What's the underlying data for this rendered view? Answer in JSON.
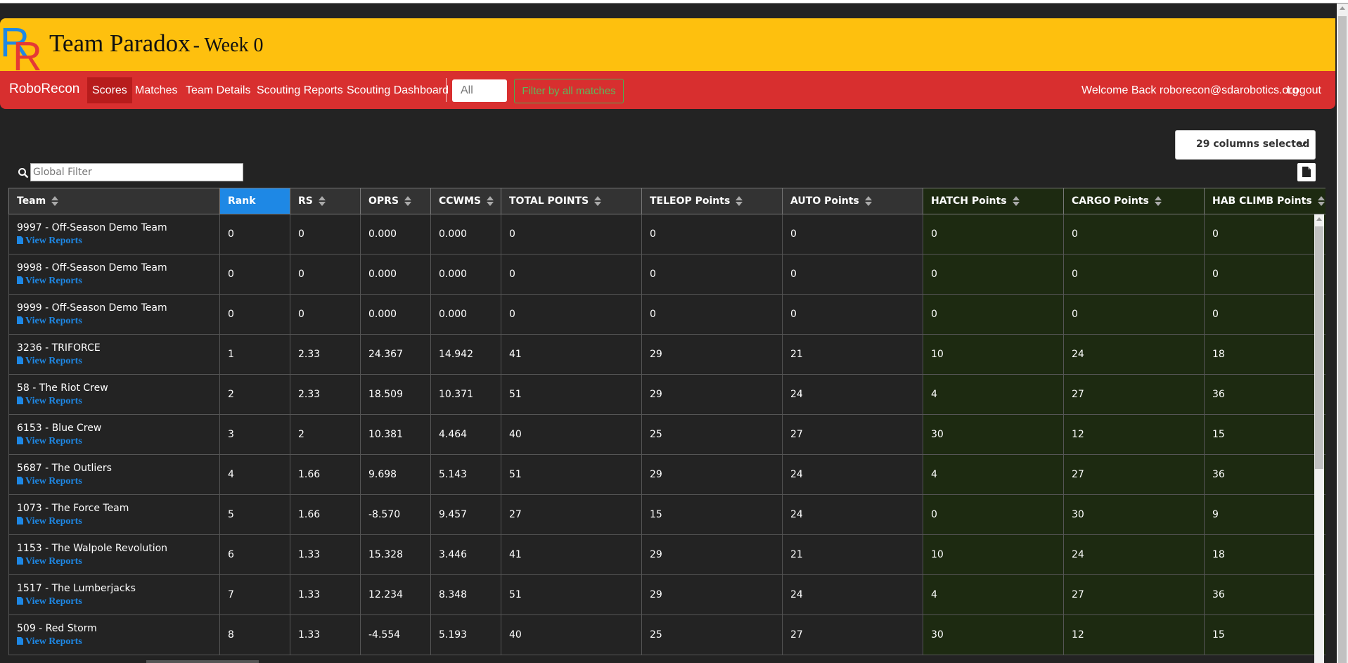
{
  "header": {
    "team": "Team Paradox",
    "week": "- Week 0",
    "logo_letters": [
      "R",
      "R"
    ],
    "colors": {
      "banner": "#fec00e",
      "navbar": "#d82f2f",
      "logo_blue": "#1e88e5",
      "logo_red": "#e53935"
    }
  },
  "nav": {
    "brand": "RoboRecon",
    "items": [
      "Scores",
      "Matches",
      "Team Details",
      "Scouting Reports",
      "Scouting Dashboard"
    ],
    "active": "Scores",
    "filter_placeholder": "All",
    "filter_button": "Filter by all matches",
    "welcome": "Welcome Back roborecon@sdarobotics.org",
    "logout": "Logout"
  },
  "toolbar": {
    "columns_selected": "29 columns selected",
    "global_filter_placeholder": "Global Filter",
    "search_icon": "search-icon",
    "export_icon": "file-icon"
  },
  "table": {
    "headers": [
      "Team",
      "Rank",
      "RS",
      "OPRS",
      "CCWMS",
      "TOTAL POINTS",
      "TELEOP Points",
      "AUTO Points",
      "HATCH Points",
      "CARGO Points",
      "HAB CLIMB Points"
    ],
    "sorted_column": "Rank",
    "link_text": "View Reports",
    "rows": [
      {
        "team": "9997 - Off-Season Demo Team",
        "cells": [
          "0",
          "0",
          "0.000",
          "0.000",
          "0",
          "0",
          "0",
          "0",
          "0",
          "0"
        ]
      },
      {
        "team": "9998 - Off-Season Demo Team",
        "cells": [
          "0",
          "0",
          "0.000",
          "0.000",
          "0",
          "0",
          "0",
          "0",
          "0",
          "0"
        ]
      },
      {
        "team": "9999 - Off-Season Demo Team",
        "cells": [
          "0",
          "0",
          "0.000",
          "0.000",
          "0",
          "0",
          "0",
          "0",
          "0",
          "0"
        ]
      },
      {
        "team": "3236 - TRIFORCE",
        "cells": [
          "1",
          "2.33",
          "24.367",
          "14.942",
          "41",
          "29",
          "21",
          "10",
          "24",
          "18"
        ]
      },
      {
        "team": "58 - The Riot Crew",
        "cells": [
          "2",
          "2.33",
          "18.509",
          "10.371",
          "51",
          "29",
          "24",
          "4",
          "27",
          "36"
        ]
      },
      {
        "team": "6153 - Blue Crew",
        "cells": [
          "3",
          "2",
          "10.381",
          "4.464",
          "40",
          "25",
          "27",
          "30",
          "12",
          "15"
        ]
      },
      {
        "team": "5687 - The Outliers",
        "cells": [
          "4",
          "1.66",
          "9.698",
          "5.143",
          "51",
          "29",
          "24",
          "4",
          "27",
          "36"
        ]
      },
      {
        "team": "1073 - The Force Team",
        "cells": [
          "5",
          "1.66",
          "-8.570",
          "9.457",
          "27",
          "15",
          "24",
          "0",
          "30",
          "9"
        ]
      },
      {
        "team": "1153 - The Walpole Revolution",
        "cells": [
          "6",
          "1.33",
          "15.328",
          "3.446",
          "41",
          "29",
          "21",
          "10",
          "24",
          "18"
        ]
      },
      {
        "team": "1517 - The Lumberjacks",
        "cells": [
          "7",
          "1.33",
          "12.234",
          "8.348",
          "51",
          "29",
          "24",
          "4",
          "27",
          "36"
        ]
      },
      {
        "team": "509 - Red Storm",
        "cells": [
          "8",
          "1.33",
          "-4.554",
          "5.193",
          "40",
          "25",
          "27",
          "30",
          "12",
          "15"
        ]
      }
    ]
  }
}
